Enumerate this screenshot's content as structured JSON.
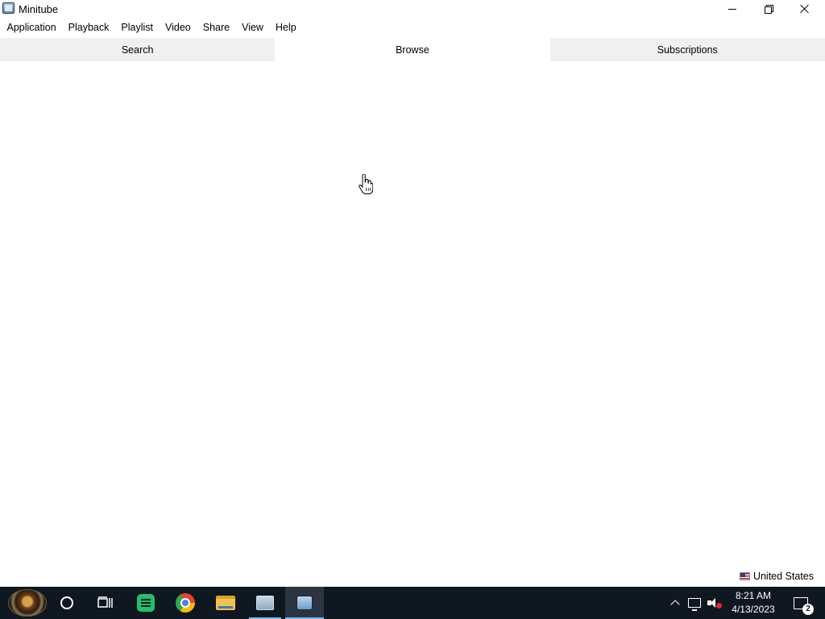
{
  "window": {
    "title": "Minitube"
  },
  "menubar": {
    "items": [
      "Application",
      "Playback",
      "Playlist",
      "Video",
      "Share",
      "View",
      "Help"
    ]
  },
  "tabs": [
    {
      "label": "Search",
      "active": false
    },
    {
      "label": "Browse",
      "active": true
    },
    {
      "label": "Subscriptions",
      "active": false
    }
  ],
  "status": {
    "region": "United States"
  },
  "taskbar": {
    "apps": [
      "start-orb-icon",
      "cortana-icon",
      "task-view-icon",
      "notes-icon",
      "chrome-icon",
      "file-explorer-icon",
      "monitor-app-icon",
      "minitube-icon"
    ],
    "clock_time": "8:21 AM",
    "clock_date": "4/13/2023",
    "notification_count": "2",
    "accent_color": "#76b9ed",
    "background_color": "#0f1821"
  }
}
